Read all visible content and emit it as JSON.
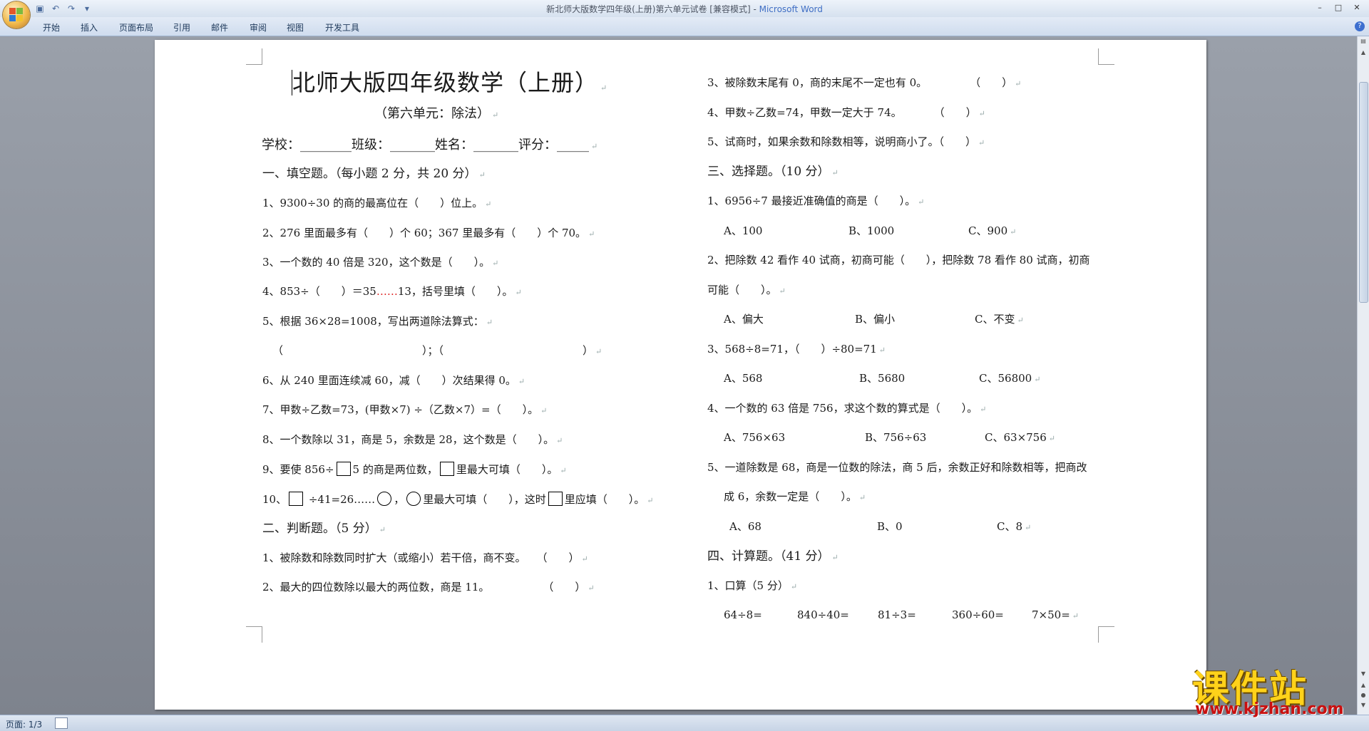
{
  "window": {
    "title": "新北师大版数学四年级(上册)第六单元试卷 [兼容模式] - ",
    "app_name": "Microsoft Word",
    "minimize": "–",
    "maximize": "□",
    "close": "✕"
  },
  "qat": {
    "save": "▣",
    "undo": "↶",
    "redo": "↷",
    "more": "▾"
  },
  "ribbon": {
    "tabs": [
      "开始",
      "插入",
      "页面布局",
      "引用",
      "邮件",
      "审阅",
      "视图",
      "开发工具"
    ],
    "help": "?"
  },
  "doc": {
    "title": "北师大版四年级数学（上册）",
    "subtitle": "（第六单元：除法）",
    "header_line": "学校：________班级：_______姓名：_______评分：_____",
    "left": [
      "一、填空题。（每小题 2 分，共 20 分）",
      "1、9300÷30 的商的最高位在（　　）位上。",
      "2、276 里面最多有（　　）个 60；367 里最多有（　　）个 70。",
      "3、一个数的 40 倍是 320，这个数是（　　）。",
      "4、853÷（　　）＝35",
      "……",
      "13，括号里填（　　）。",
      "5、根据 36×28=1008，写出两道除法算式：",
      "（　　　　　　　　　　　　　）；（　　　　　　　　　　　　　）",
      "6、从 240 里面连续减 60，减（　　）次结果得 0。",
      "7、甲数÷乙数=73，(甲数×7) ÷（乙数×7）=（　　）。",
      "8、一个数除以 31，商是 5，余数是 28，这个数是（　　）。",
      "9、要使 856÷",
      "5 的商是两位数，",
      "里最大可填（　　）。",
      "10、",
      " ÷41=26……",
      "，",
      "里最大可填（　　），这时",
      "里应填（　　）。",
      "二、判断题。（5 分）",
      "1、被除数和除数同时扩大（或缩小）若干倍，商不变。　　（　　）",
      "2、最大的四位数除以最大的两位数，商是 11。　　　　　　（　　）"
    ],
    "right": [
      "3、被除数末尾有 0，商的末尾不一定也有 0。　　　　　（　　）",
      "4、甲数÷乙数=74，甲数一定大于 74。　　　　（　　）",
      "5、试商时，如果余数和除数相等，说明商小了。（　　）",
      "三、选择题。（10 分）",
      "1、6956÷7 最接近准确值的商是（　　）。",
      "A、100",
      "B、1000",
      "C、900",
      "2、把除数 42 看作 40 试商，初商可能（　　），把除数 78 看作 80 试商，初商",
      "可能（　　）。",
      "A、偏大",
      "B、偏小",
      "C、不变",
      "3、568÷8=71，（　　）÷80=71",
      "A、568",
      "B、5680",
      "C、56800",
      "4、一个数的 63 倍是 756，求这个数的算式是（　　）。",
      "A、756×63",
      "B、756÷63",
      "C、63×756",
      "5、一道除数是 68，商是一位数的除法，商 5 后，余数正好和除数相等，把商改",
      "成 6，余数一定是（　　）。",
      "A、68",
      "B、0",
      "C、8",
      "四、计算题。（41 分）",
      "1、口算（5 分）",
      "64÷8=",
      "840÷40=",
      "81÷3=",
      "360÷60=",
      "7×50="
    ],
    "para_mark": "↵"
  },
  "status": {
    "page": "页面: 1/3"
  },
  "watermark": {
    "brand": "课件站",
    "url": "www.kjzhan.com"
  },
  "colors": {
    "app_name": "#3f6ec4",
    "watermark_brand": "#ffd21a",
    "watermark_url": "#c81010"
  }
}
